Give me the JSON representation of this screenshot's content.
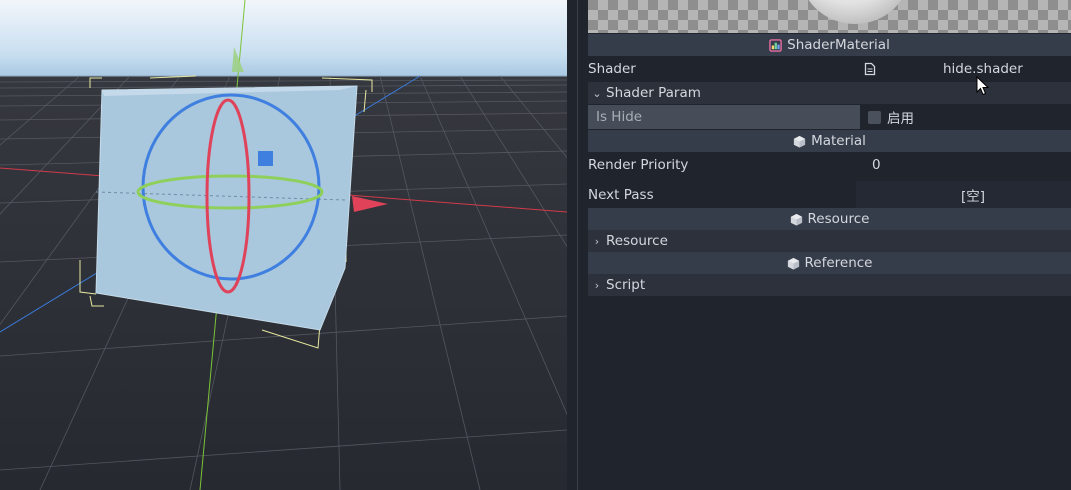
{
  "inspector": {
    "resource_type": "ShaderMaterial",
    "shader": {
      "label": "Shader",
      "value": "hide.shader"
    },
    "shader_param": {
      "label": "Shader Param",
      "is_hide_label": "Is Hide",
      "is_hide_option": "启用",
      "is_hide_checked": false
    },
    "material_section": "Material",
    "render_priority": {
      "label": "Render Priority",
      "value": "0"
    },
    "next_pass": {
      "label": "Next Pass",
      "value": "[空]"
    },
    "resource_section": "Resource",
    "resource_category": "Resource",
    "reference_section": "Reference",
    "script_category": "Script"
  },
  "colors": {
    "section_bg": "#363d4a",
    "panel_bg": "#20242d",
    "gizmo_red": "#e0425a",
    "gizmo_green": "#8fd05a",
    "gizmo_blue": "#3f7fe0",
    "cube": "#a9c7dd"
  },
  "icons": [
    "shader-material-icon",
    "shader-file-icon",
    "cube-icon",
    "chevron-down-icon",
    "chevron-right-icon",
    "mouse-cursor-icon"
  ]
}
